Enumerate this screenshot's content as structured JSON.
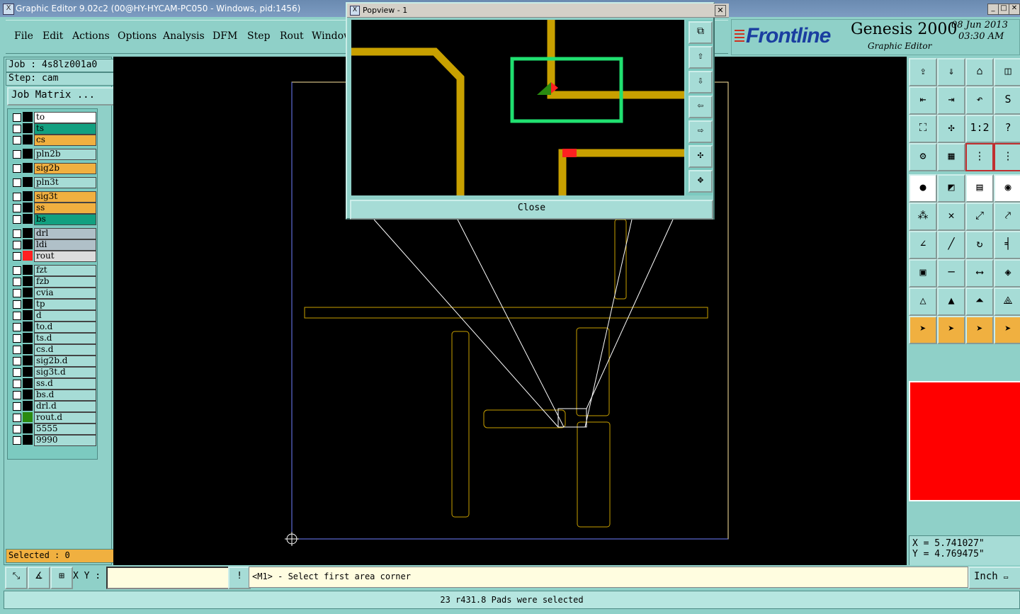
{
  "window": {
    "title": "Graphic Editor 9.02c2 (00@HY-HYCAM-PC050 - Windows, pid:1456)"
  },
  "menu": [
    "File",
    "Edit",
    "Actions",
    "Options",
    "Analysis",
    "DFM",
    "Step",
    "Rout",
    "Window"
  ],
  "brand": {
    "logo": "Frontline",
    "product": "Genesis 2000",
    "subtitle": "Graphic Editor",
    "date": "08 Jun 2013",
    "time": "03:30 AM"
  },
  "job": {
    "job_label": "Job : 4s8lz001a0",
    "step_label": "Step: cam",
    "matrix_button": "Job Matrix ..."
  },
  "layers": [
    {
      "name": "to",
      "color": "#ffffff"
    },
    {
      "name": "ts",
      "color": "#12a080"
    },
    {
      "name": "cs",
      "color": "#f0b040"
    },
    {
      "name": "pln2b",
      "color": "#a6dcd6"
    },
    {
      "name": "sig2b",
      "color": "#f0b040"
    },
    {
      "name": "pln3t",
      "color": "#a6dcd6"
    },
    {
      "name": "sig3t",
      "color": "#f0b040"
    },
    {
      "name": "ss",
      "color": "#f0b040"
    },
    {
      "name": "bs",
      "color": "#12a080"
    },
    {
      "name": "drl",
      "color": "#b0c0c8"
    },
    {
      "name": "ldi",
      "color": "#b0c0c8"
    },
    {
      "name": "rout",
      "color": "#dcdcdc"
    },
    {
      "name": "fzt",
      "color": "#a6dcd6"
    },
    {
      "name": "fzb",
      "color": "#a6dcd6"
    },
    {
      "name": "cvia",
      "color": "#a6dcd6"
    },
    {
      "name": "tp",
      "color": "#a6dcd6"
    },
    {
      "name": "d",
      "color": "#a6dcd6"
    },
    {
      "name": "to.d",
      "color": "#a6dcd6"
    },
    {
      "name": "ts.d",
      "color": "#a6dcd6"
    },
    {
      "name": "cs.d",
      "color": "#a6dcd6"
    },
    {
      "name": "sig2b.d",
      "color": "#a6dcd6"
    },
    {
      "name": "sig3t.d",
      "color": "#a6dcd6"
    },
    {
      "name": "ss.d",
      "color": "#a6dcd6"
    },
    {
      "name": "bs.d",
      "color": "#a6dcd6"
    },
    {
      "name": "drl.d",
      "color": "#a6dcd6"
    },
    {
      "name": "rout.d",
      "color": "#a6dcd6"
    },
    {
      "name": "5555",
      "color": "#a6dcd6"
    },
    {
      "name": "9990",
      "color": "#a6dcd6"
    }
  ],
  "selected_label": "Selected : 0",
  "popview": {
    "title": "Popview - 1",
    "close_label": "Close"
  },
  "coords": {
    "x": "X = 5.741027\"",
    "y": "Y = 4.769475\""
  },
  "input": {
    "xy_label": "X Y :",
    "xy_value": ""
  },
  "prompt": "<M1> - Select first area corner",
  "unit": "Inch",
  "status": "23 r431.8 Pads were selected",
  "colors": {
    "board_outline": "#ffe8a0",
    "trace": "#c8a000",
    "highlight": "#20e070",
    "overview": "#ff0000"
  }
}
